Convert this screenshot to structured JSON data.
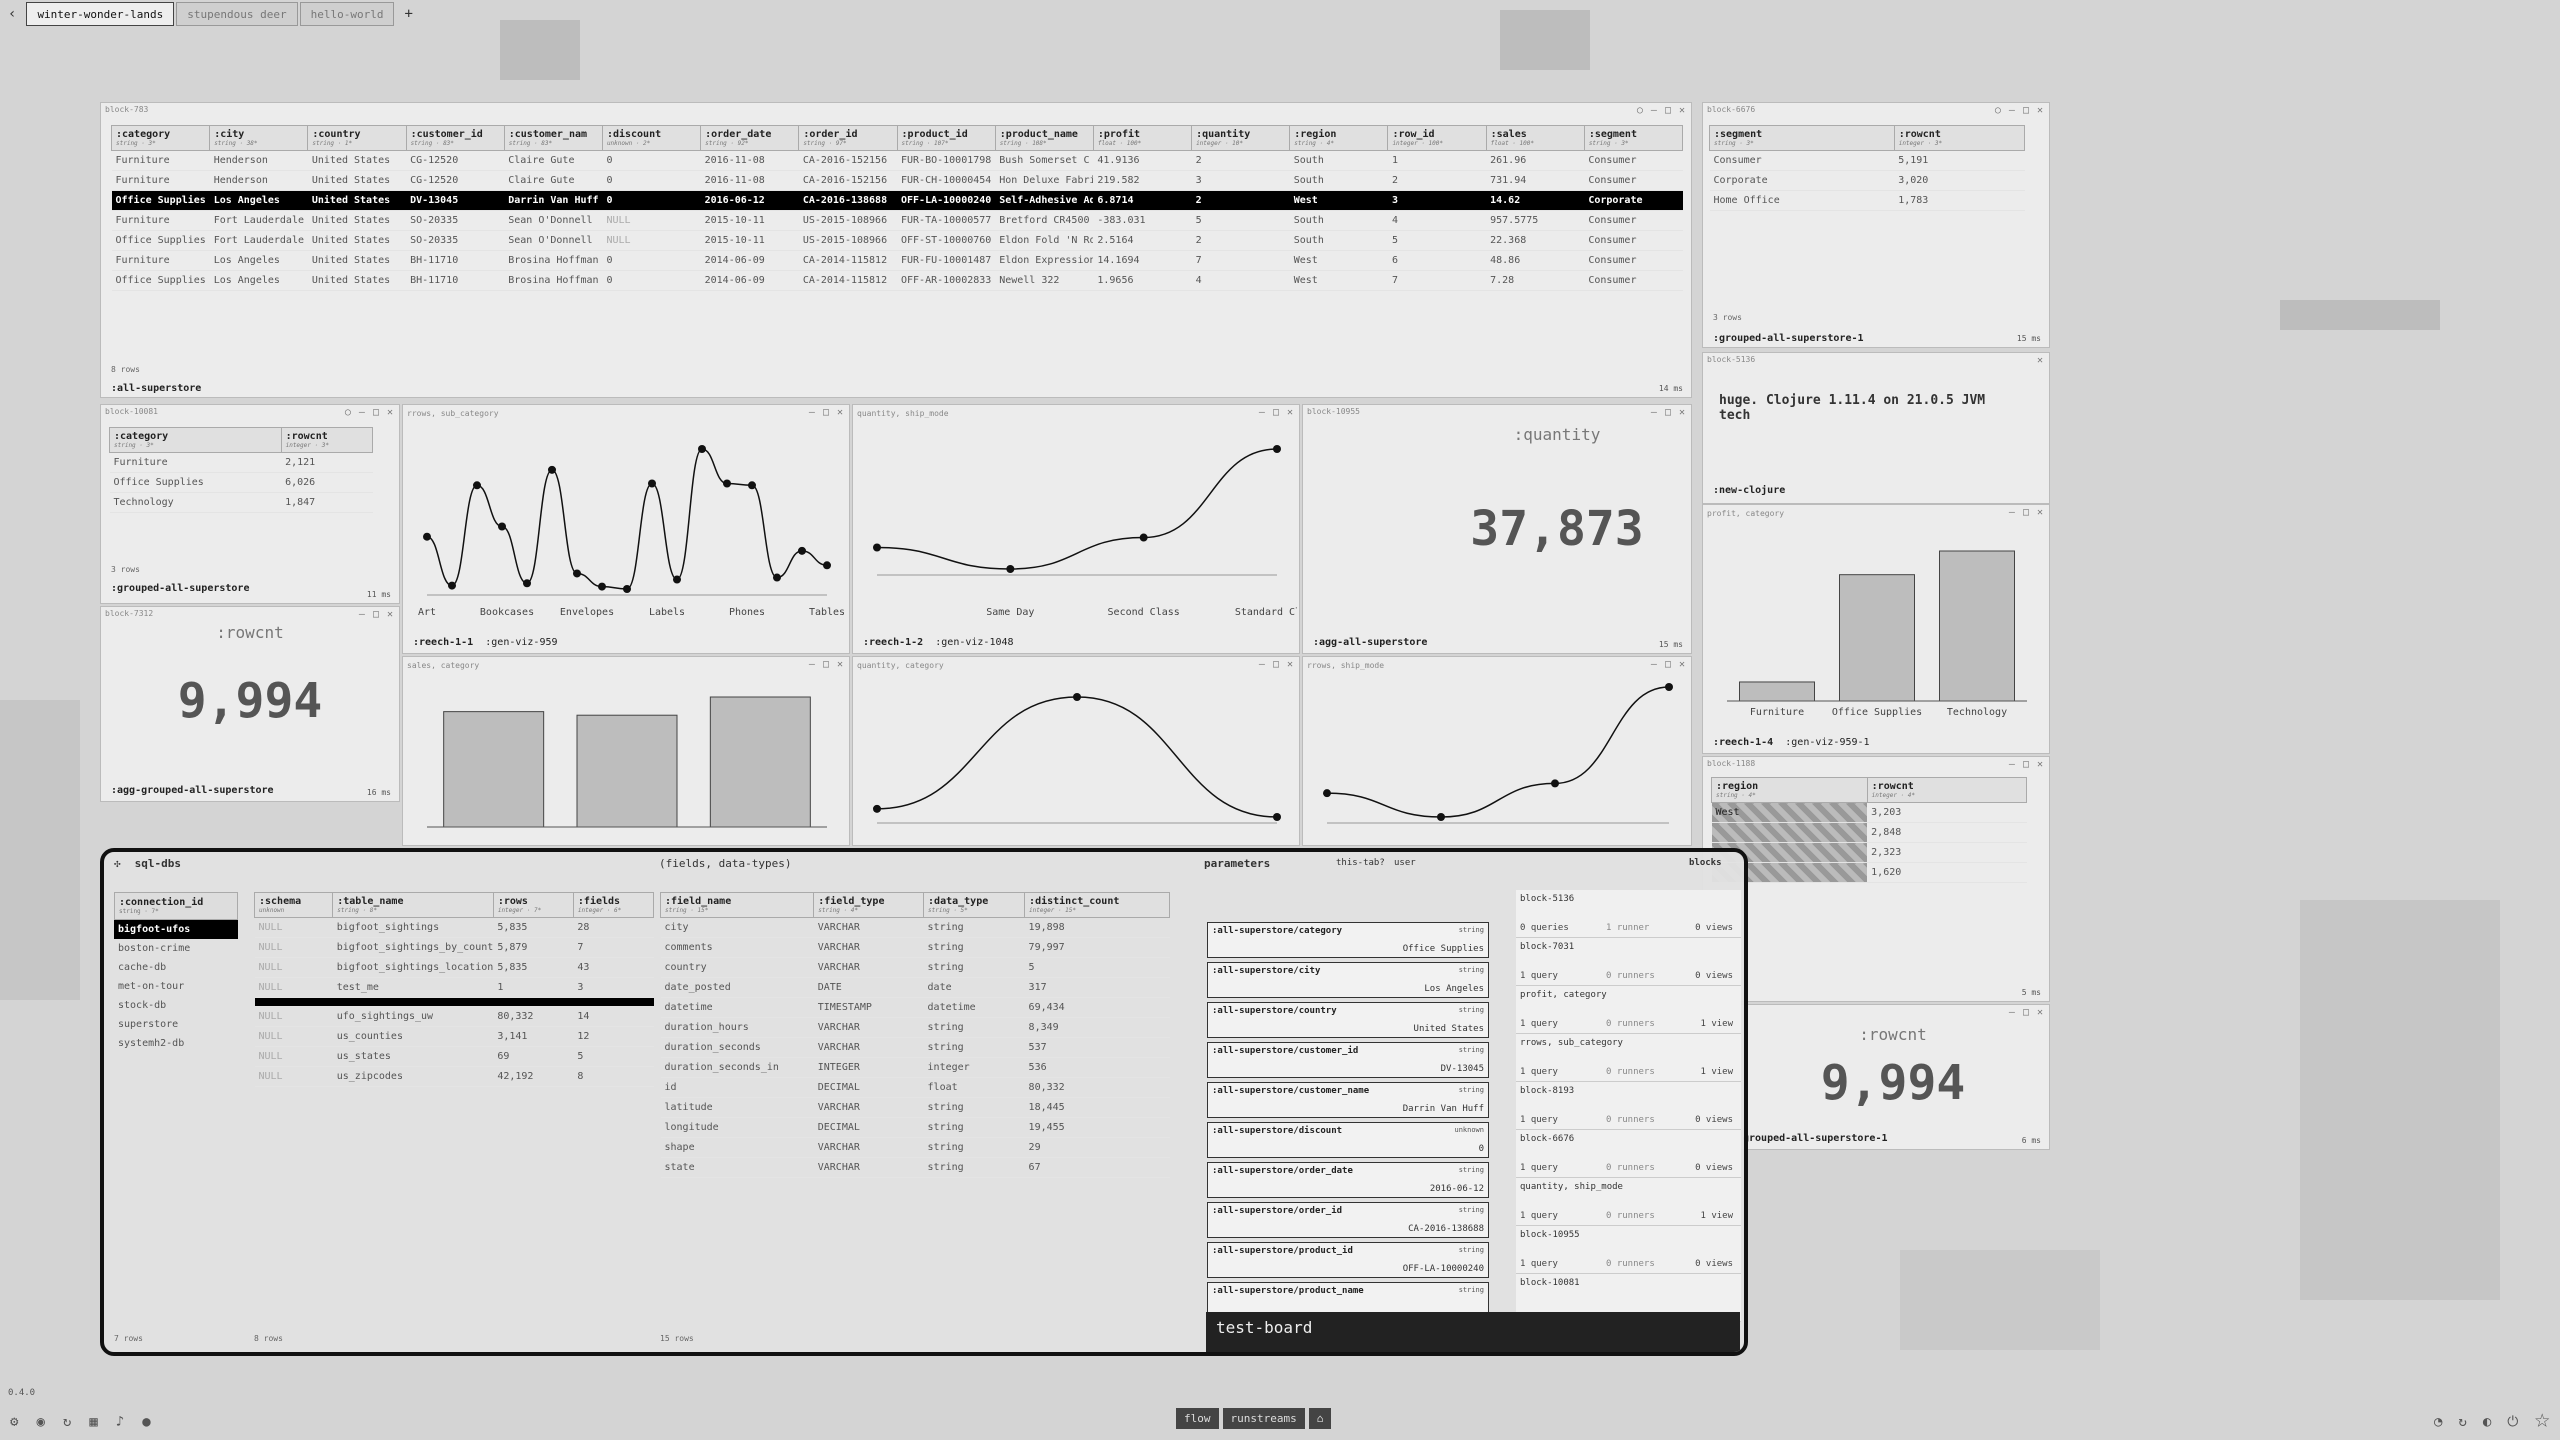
{
  "tabs": [
    "winter-wonder-lands",
    "stupendous deer",
    "hello-world"
  ],
  "main_table": {
    "title": "block-783",
    "columns": [
      {
        "name": ":category",
        "type": "string · 3*"
      },
      {
        "name": ":city",
        "type": "string · 38*"
      },
      {
        "name": ":country",
        "type": "string · 1*"
      },
      {
        "name": ":customer_id",
        "type": "string · 83*"
      },
      {
        "name": ":customer_nam",
        "type": "string · 83*"
      },
      {
        "name": ":discount",
        "type": "unknown · 2*"
      },
      {
        "name": ":order_date",
        "type": "string · 92*"
      },
      {
        "name": ":order_id",
        "type": "string · 97*"
      },
      {
        "name": ":product_id",
        "type": "string · 107*"
      },
      {
        "name": ":product_name",
        "type": "string · 108*"
      },
      {
        "name": ":profit",
        "type": "float · 100*"
      },
      {
        "name": ":quantity",
        "type": "integer · 10*"
      },
      {
        "name": ":region",
        "type": "string · 4*"
      },
      {
        "name": ":row_id",
        "type": "integer · 100*"
      },
      {
        "name": ":sales",
        "type": "float · 100*"
      },
      {
        "name": ":segment",
        "type": "string · 3*"
      }
    ],
    "rows": [
      [
        "Furniture",
        "Henderson",
        "United States",
        "CG-12520",
        "Claire Gute",
        "0",
        "2016-11-08",
        "CA-2016-152156",
        "FUR-BO-10001798",
        "Bush Somerset C",
        "41.9136",
        "2",
        "South",
        "1",
        "261.96",
        "Consumer"
      ],
      [
        "Furniture",
        "Henderson",
        "United States",
        "CG-12520",
        "Claire Gute",
        "0",
        "2016-11-08",
        "CA-2016-152156",
        "FUR-CH-10000454",
        "Hon Deluxe Fabri",
        "219.582",
        "3",
        "South",
        "2",
        "731.94",
        "Consumer"
      ],
      [
        "Office Supplies",
        "Los Angeles",
        "United States",
        "DV-13045",
        "Darrin Van Huff",
        "0",
        "2016-06-12",
        "CA-2016-138688",
        "OFF-LA-10000240",
        "Self-Adhesive Ad",
        "6.8714",
        "2",
        "West",
        "3",
        "14.62",
        "Corporate"
      ],
      [
        "Furniture",
        "Fort Lauderdale",
        "United States",
        "SO-20335",
        "Sean O'Donnell",
        "NULL",
        "2015-10-11",
        "US-2015-108966",
        "FUR-TA-10000577",
        "Bretford CR4500",
        "-383.031",
        "5",
        "South",
        "4",
        "957.5775",
        "Consumer"
      ],
      [
        "Office Supplies",
        "Fort Lauderdale",
        "United States",
        "SO-20335",
        "Sean O'Donnell",
        "NULL",
        "2015-10-11",
        "US-2015-108966",
        "OFF-ST-10000760",
        "Eldon Fold 'N Roll",
        "2.5164",
        "2",
        "South",
        "5",
        "22.368",
        "Consumer"
      ],
      [
        "Furniture",
        "Los Angeles",
        "United States",
        "BH-11710",
        "Brosina Hoffman",
        "0",
        "2014-06-09",
        "CA-2014-115812",
        "FUR-FU-10001487",
        "Eldon Expression",
        "14.1694",
        "7",
        "West",
        "6",
        "48.86",
        "Consumer"
      ],
      [
        "Office Supplies",
        "Los Angeles",
        "United States",
        "BH-11710",
        "Brosina Hoffman",
        "0",
        "2014-06-09",
        "CA-2014-115812",
        "OFF-AR-10002833",
        "Newell 322",
        "1.9656",
        "4",
        "West",
        "7",
        "7.28",
        "Consumer"
      ]
    ],
    "rows_label": "8 rows",
    "query_name": ":all-superstore",
    "ms": "14 ms"
  },
  "segment_table": {
    "title": "block-6676",
    "columns": [
      {
        "name": ":segment",
        "type": "string · 3*"
      },
      {
        "name": ":rowcnt",
        "type": "integer · 3*"
      }
    ],
    "rows": [
      [
        "Consumer",
        "5,191"
      ],
      [
        "Corporate",
        "3,020"
      ],
      [
        "Home Office",
        "1,783"
      ]
    ],
    "rows_label": "3 rows",
    "query_name": ":grouped-all-superstore-1",
    "ms": "15 ms"
  },
  "category_table": {
    "title": "block-10081",
    "columns": [
      {
        "name": ":category",
        "type": "string · 3*"
      },
      {
        "name": ":rowcnt",
        "type": "integer · 3*"
      }
    ],
    "rows": [
      [
        "Furniture",
        "2,121"
      ],
      [
        "Office Supplies",
        "6,026"
      ],
      [
        "Technology",
        "1,847"
      ]
    ],
    "rows_label": "3 rows",
    "query_name": ":grouped-all-superstore",
    "ms": "11 ms"
  },
  "rowcnt_card": {
    "title": "block-7312",
    "label": ":rowcnt",
    "value": "9,994",
    "query_name": ":agg-grouped-all-superstore",
    "ms": "16 ms"
  },
  "quantity_card": {
    "title": "block-10955",
    "label": ":quantity",
    "value": "37,873",
    "query_name": ":agg-all-superstore",
    "ms": "15 ms"
  },
  "clojure_card": {
    "title": "block-5136",
    "text": "huge. Clojure 1.11.4 on 21.0.5 JVM tech",
    "query_name": ":new-clojure"
  },
  "region_table": {
    "title": "block-1188",
    "columns": [
      {
        "name": ":region",
        "type": "string · 4*"
      },
      {
        "name": ":rowcnt",
        "type": "integer · 4*"
      }
    ],
    "rows": [
      [
        "West",
        "3,203"
      ],
      [
        "",
        "2,848"
      ],
      [
        "",
        "2,323"
      ],
      [
        "",
        "1,620"
      ]
    ],
    "ms": "5 ms"
  },
  "rowcnt_card2": {
    "label": ":rowcnt",
    "value": "9,994",
    "query_name": "grouped-all-superstore-1",
    "ms": "6 ms"
  },
  "chart_data": [
    {
      "type": "line",
      "title": "rrows, sub_category",
      "categories": [
        "Art",
        "Bookcases",
        "",
        "Envelopes",
        "",
        "Labels",
        "",
        "Phones",
        "",
        "Tables"
      ],
      "tick_labels": [
        "Art",
        "Bookcases",
        "Envelopes",
        "Labels",
        "Phones",
        "Tables"
      ],
      "values": [
        775,
        228,
        1350,
        889,
        254,
        1523,
        364,
        217,
        190,
        1370,
        296,
        1756,
        1370,
        1350,
        318,
        617,
        455
      ],
      "query_name": ":reech-1-1",
      "sub_name": ":gen-viz-959"
    },
    {
      "type": "line",
      "title": "quantity, ship_mode",
      "categories": [
        "First Class",
        "Same Day",
        "Second Class",
        "Standard Class"
      ],
      "tick_labels": [
        "Same Day",
        "Second Class",
        "Standard Class"
      ],
      "values": [
        5693,
        1960,
        7423,
        22797
      ],
      "query_name": ":reech-1-2",
      "sub_name": ":gen-viz-1048"
    },
    {
      "type": "bar",
      "title": "profit, category",
      "categories": [
        "Furniture",
        "Office Supplies",
        "Technology"
      ],
      "values": [
        18451,
        122491,
        145455
      ],
      "query_name": ":reech-1-4",
      "sub_name": ":gen-viz-959-1"
    },
    {
      "type": "bar",
      "title": "sales, category",
      "categories": [
        "Furniture",
        "Office Supplies",
        "Technology"
      ],
      "values": [
        742000,
        719047,
        836154
      ]
    },
    {
      "type": "line",
      "title": "quantity, category",
      "categories": [
        "Furniture",
        "Office Supplies",
        "Technology"
      ],
      "values": [
        8028,
        22906,
        6939
      ]
    },
    {
      "type": "line",
      "title": "rrows, ship_mode",
      "categories": [
        "First Class",
        "Same Day",
        "Second Class",
        "Standard Class"
      ],
      "values": [
        1538,
        543,
        1945,
        5968
      ]
    }
  ],
  "sql": {
    "header": [
      "sql-dbs",
      "fields, data-types"
    ],
    "parameters_label": "parameters",
    "param_tabs": [
      "this-tab?",
      "user"
    ],
    "blocks_label": "blocks",
    "connections_header": {
      "name": ":connection_id",
      "type": "string · 7*"
    },
    "connections": [
      "bigfoot-ufos",
      "boston-crime",
      "cache-db",
      "met-on-tour",
      "stock-db",
      "superstore",
      "systemh2-db"
    ],
    "conn_rows": "7 rows",
    "tables_columns": [
      {
        "name": ":schema",
        "type": "unknown"
      },
      {
        "name": ":table_name",
        "type": "string · 8*"
      },
      {
        "name": ":rows",
        "type": "integer · 7*"
      },
      {
        "name": ":fields",
        "type": "integer · 6*"
      }
    ],
    "tables": [
      [
        "NULL",
        "bigfoot_sightings",
        "5,835",
        "28"
      ],
      [
        "NULL",
        "bigfoot_sightings_by_country_co",
        "5,879",
        "7"
      ],
      [
        "NULL",
        "bigfoot_sightings_locations",
        "5,835",
        "43"
      ],
      [
        "NULL",
        "test_me",
        "1",
        "3"
      ],
      [
        "",
        "",
        "",
        ""
      ],
      [
        "NULL",
        "ufo_sightings_uw",
        "80,332",
        "14"
      ],
      [
        "NULL",
        "us_counties",
        "3,141",
        "12"
      ],
      [
        "NULL",
        "us_states",
        "69",
        "5"
      ],
      [
        "NULL",
        "us_zipcodes",
        "42,192",
        "8"
      ]
    ],
    "table_rows": "8 rows",
    "fields_columns": [
      {
        "name": ":field_name",
        "type": "string · 15*"
      },
      {
        "name": ":field_type",
        "type": "string · 4*"
      },
      {
        "name": ":data_type",
        "type": "string · 5*"
      },
      {
        "name": ":distinct_count",
        "type": "integer · 15*"
      }
    ],
    "fields": [
      [
        "city",
        "VARCHAR",
        "string",
        "19,898"
      ],
      [
        "comments",
        "VARCHAR",
        "string",
        "79,997"
      ],
      [
        "country",
        "VARCHAR",
        "string",
        "5"
      ],
      [
        "date_posted",
        "DATE",
        "date",
        "317"
      ],
      [
        "datetime",
        "TIMESTAMP",
        "datetime",
        "69,434"
      ],
      [
        "duration_hours",
        "VARCHAR",
        "string",
        "8,349"
      ],
      [
        "duration_seconds",
        "VARCHAR",
        "string",
        "537"
      ],
      [
        "duration_seconds_in",
        "INTEGER",
        "integer",
        "536"
      ],
      [
        "id",
        "DECIMAL",
        "float",
        "80,332"
      ],
      [
        "latitude",
        "VARCHAR",
        "string",
        "18,445"
      ],
      [
        "longitude",
        "DECIMAL",
        "string",
        "19,455"
      ],
      [
        "shape",
        "VARCHAR",
        "string",
        "29"
      ],
      [
        "state",
        "VARCHAR",
        "string",
        "67"
      ]
    ],
    "field_rows": "15 rows",
    "params": [
      {
        "name": ":all-superstore/category",
        "type": "string",
        "value": "Office Supplies"
      },
      {
        "name": ":all-superstore/city",
        "type": "string",
        "value": "Los Angeles"
      },
      {
        "name": ":all-superstore/country",
        "type": "string",
        "value": "United States"
      },
      {
        "name": ":all-superstore/customer_id",
        "type": "string",
        "value": "DV-13045"
      },
      {
        "name": ":all-superstore/customer_name",
        "type": "string",
        "value": "Darrin Van Huff"
      },
      {
        "name": ":all-superstore/discount",
        "type": "unknown",
        "value": "0"
      },
      {
        "name": ":all-superstore/order_date",
        "type": "string",
        "value": "2016-06-12"
      },
      {
        "name": ":all-superstore/order_id",
        "type": "string",
        "value": "CA-2016-138688"
      },
      {
        "name": ":all-superstore/product_id",
        "type": "string",
        "value": "OFF-LA-10000240"
      },
      {
        "name": ":all-superstore/product_name",
        "type": "string",
        "value": ""
      }
    ],
    "blocks": [
      {
        "name": "block-5136",
        "q": "0 queries",
        "r": "1 runner",
        "v": "0 views"
      },
      {
        "name": "block-7031",
        "q": "1 query",
        "r": "0 runners",
        "v": "0 views"
      },
      {
        "name": "profit, category",
        "q": "1 query",
        "r": "0 runners",
        "v": "1 view"
      },
      {
        "name": "rrows, sub_category",
        "q": "1 query",
        "r": "0 runners",
        "v": "1 view"
      },
      {
        "name": "block-8193",
        "q": "1 query",
        "r": "0 runners",
        "v": "0 views"
      },
      {
        "name": "block-6676",
        "q": "1 query",
        "r": "0 runners",
        "v": "0 views"
      },
      {
        "name": "quantity, ship_mode",
        "q": "1 query",
        "r": "0 runners",
        "v": "1 view"
      },
      {
        "name": "block-10955",
        "q": "1 query",
        "r": "0 runners",
        "v": "0 views"
      },
      {
        "name": "block-10081",
        "q": "",
        "r": "",
        "v": ""
      }
    ],
    "testboard": "test-board"
  },
  "bottombar": [
    "flow",
    "runstreams"
  ],
  "version": "0.4.0"
}
